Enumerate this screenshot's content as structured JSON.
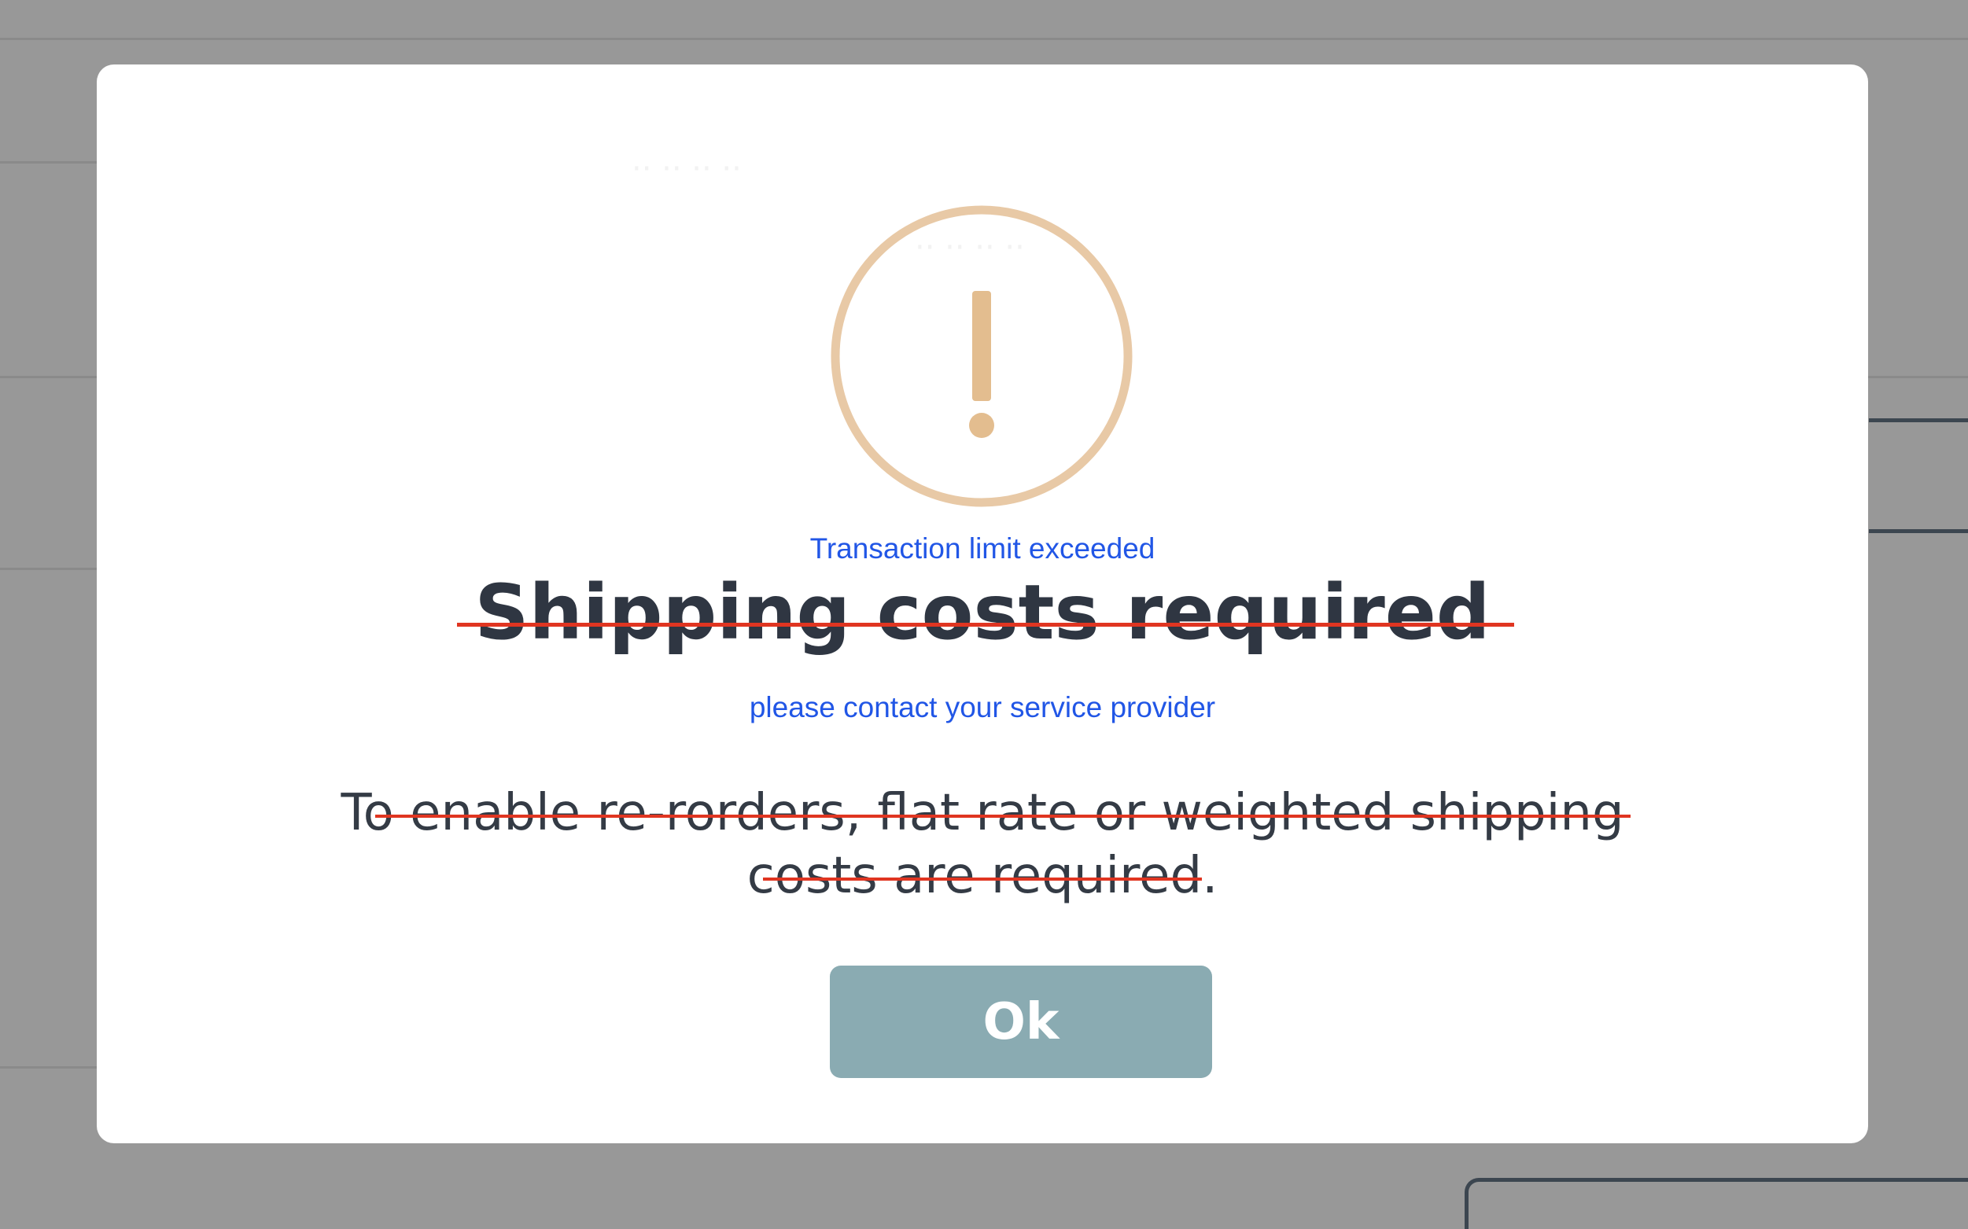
{
  "dialog": {
    "title": "Shipping costs required",
    "title_correction": "Transaction limit exceeded",
    "message_correction": "please contact your service provider",
    "message_line1_prefix": "To",
    "message_line1_struck": " enable re-rorders, flat rate or weighted shipping",
    "message_line2_struck": "costs are required",
    "message_line2_suffix": ".",
    "ok_label": "Ok"
  },
  "icons": {
    "alert": "exclamation-circle-icon"
  },
  "colors": {
    "overlay": "#989898",
    "modal_background": "#ffffff",
    "icon": "#e8c9a6",
    "title_text": "#2f3642",
    "body_text": "#343b45",
    "strike": "#e03521",
    "correction_text": "#2156e6",
    "ok_button": "#8aabb2",
    "ok_button_text": "#ffffff"
  }
}
